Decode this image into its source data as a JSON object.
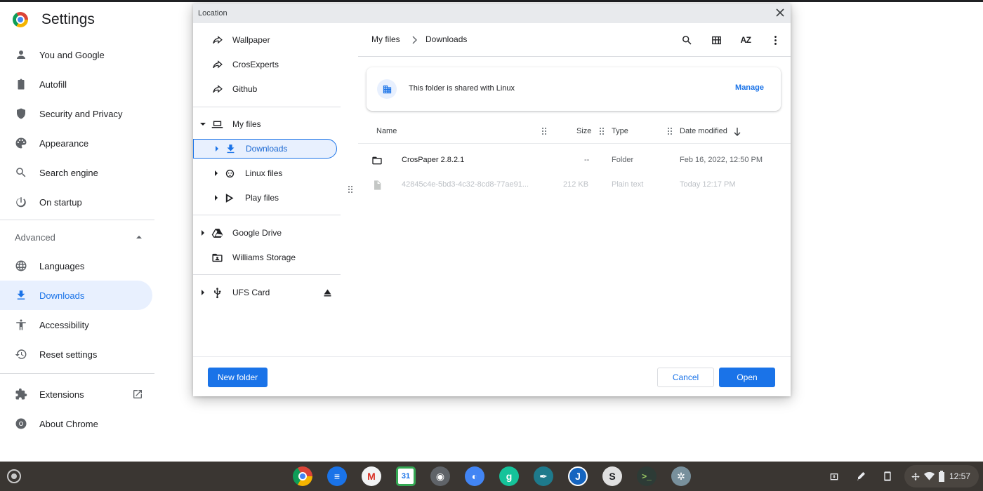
{
  "settings": {
    "title": "Settings",
    "nav": [
      {
        "label": "You and Google",
        "icon": "person-icon"
      },
      {
        "label": "Autofill",
        "icon": "clipboard-icon"
      },
      {
        "label": "Security and Privacy",
        "icon": "shield-icon"
      },
      {
        "label": "Appearance",
        "icon": "palette-icon"
      },
      {
        "label": "Search engine",
        "icon": "search-icon"
      },
      {
        "label": "On startup",
        "icon": "power-icon"
      }
    ],
    "advanced_label": "Advanced",
    "advanced_nav": [
      {
        "label": "Languages",
        "icon": "globe-icon"
      },
      {
        "label": "Downloads",
        "icon": "download-icon",
        "active": true
      },
      {
        "label": "Accessibility",
        "icon": "accessibility-icon"
      },
      {
        "label": "Reset settings",
        "icon": "history-icon"
      }
    ],
    "bottom_nav": [
      {
        "label": "Extensions",
        "icon": "puzzle-icon"
      },
      {
        "label": "About Chrome",
        "icon": "chrome-icon"
      }
    ]
  },
  "dialog": {
    "title": "Location",
    "tree": {
      "shortcuts": [
        {
          "label": "Wallpaper",
          "icon": "shortcut-arrow-icon"
        },
        {
          "label": "CrosExperts",
          "icon": "shortcut-arrow-icon"
        },
        {
          "label": "Github",
          "icon": "shortcut-arrow-icon"
        }
      ],
      "my_files": "My files",
      "children": [
        {
          "label": "Downloads",
          "icon": "download-icon",
          "selected": true
        },
        {
          "label": "Linux files",
          "icon": "linux-icon"
        },
        {
          "label": "Play files",
          "icon": "play-icon"
        }
      ],
      "google_drive": "Google Drive",
      "williams_storage": "Williams Storage",
      "ufs_card": "UFS Card"
    },
    "breadcrumb": [
      "My files",
      "Downloads"
    ],
    "toolbar": {
      "search": "search-icon",
      "grid": "grid-view-icon",
      "sort_label": "AZ",
      "more": "more-vert-icon"
    },
    "banner": {
      "text": "This folder is shared with Linux",
      "action": "Manage"
    },
    "columns": {
      "name": "Name",
      "size": "Size",
      "type": "Type",
      "date": "Date modified"
    },
    "files": [
      {
        "name": "CrosPaper 2.8.2.1",
        "size": "--",
        "type": "Folder",
        "date": "Feb 16, 2022, 12:50 PM",
        "icon": "folder-icon",
        "dim": false
      },
      {
        "name": "42845c4e-5bd3-4c32-8cd8-77ae91...",
        "size": "212 KB",
        "type": "Plain text",
        "date": "Today 12:17 PM",
        "icon": "file-icon",
        "dim": true
      }
    ],
    "buttons": {
      "new_folder": "New folder",
      "cancel": "Cancel",
      "open": "Open"
    }
  },
  "shelf": {
    "apps": [
      {
        "name": "chrome-app",
        "color": "#db4437"
      },
      {
        "name": "messages-app",
        "color": "#1a73e8"
      },
      {
        "name": "gmail-app",
        "color": "#ffffff"
      },
      {
        "name": "calendar-app",
        "color": "#1a73e8"
      },
      {
        "name": "feed-app",
        "color": "#5f6368"
      },
      {
        "name": "browser-app",
        "color": "#4285f4"
      },
      {
        "name": "grammar-app",
        "color": "#15c39a"
      },
      {
        "name": "pen-app",
        "color": "#1e7a8c"
      },
      {
        "name": "jot-app",
        "color": "#1565c0"
      },
      {
        "name": "s-app",
        "color": "#e0e0e0"
      },
      {
        "name": "terminal-app",
        "color": "#2d3b36"
      },
      {
        "name": "crab-app",
        "color": "#78909c"
      }
    ],
    "time": "12:57"
  }
}
